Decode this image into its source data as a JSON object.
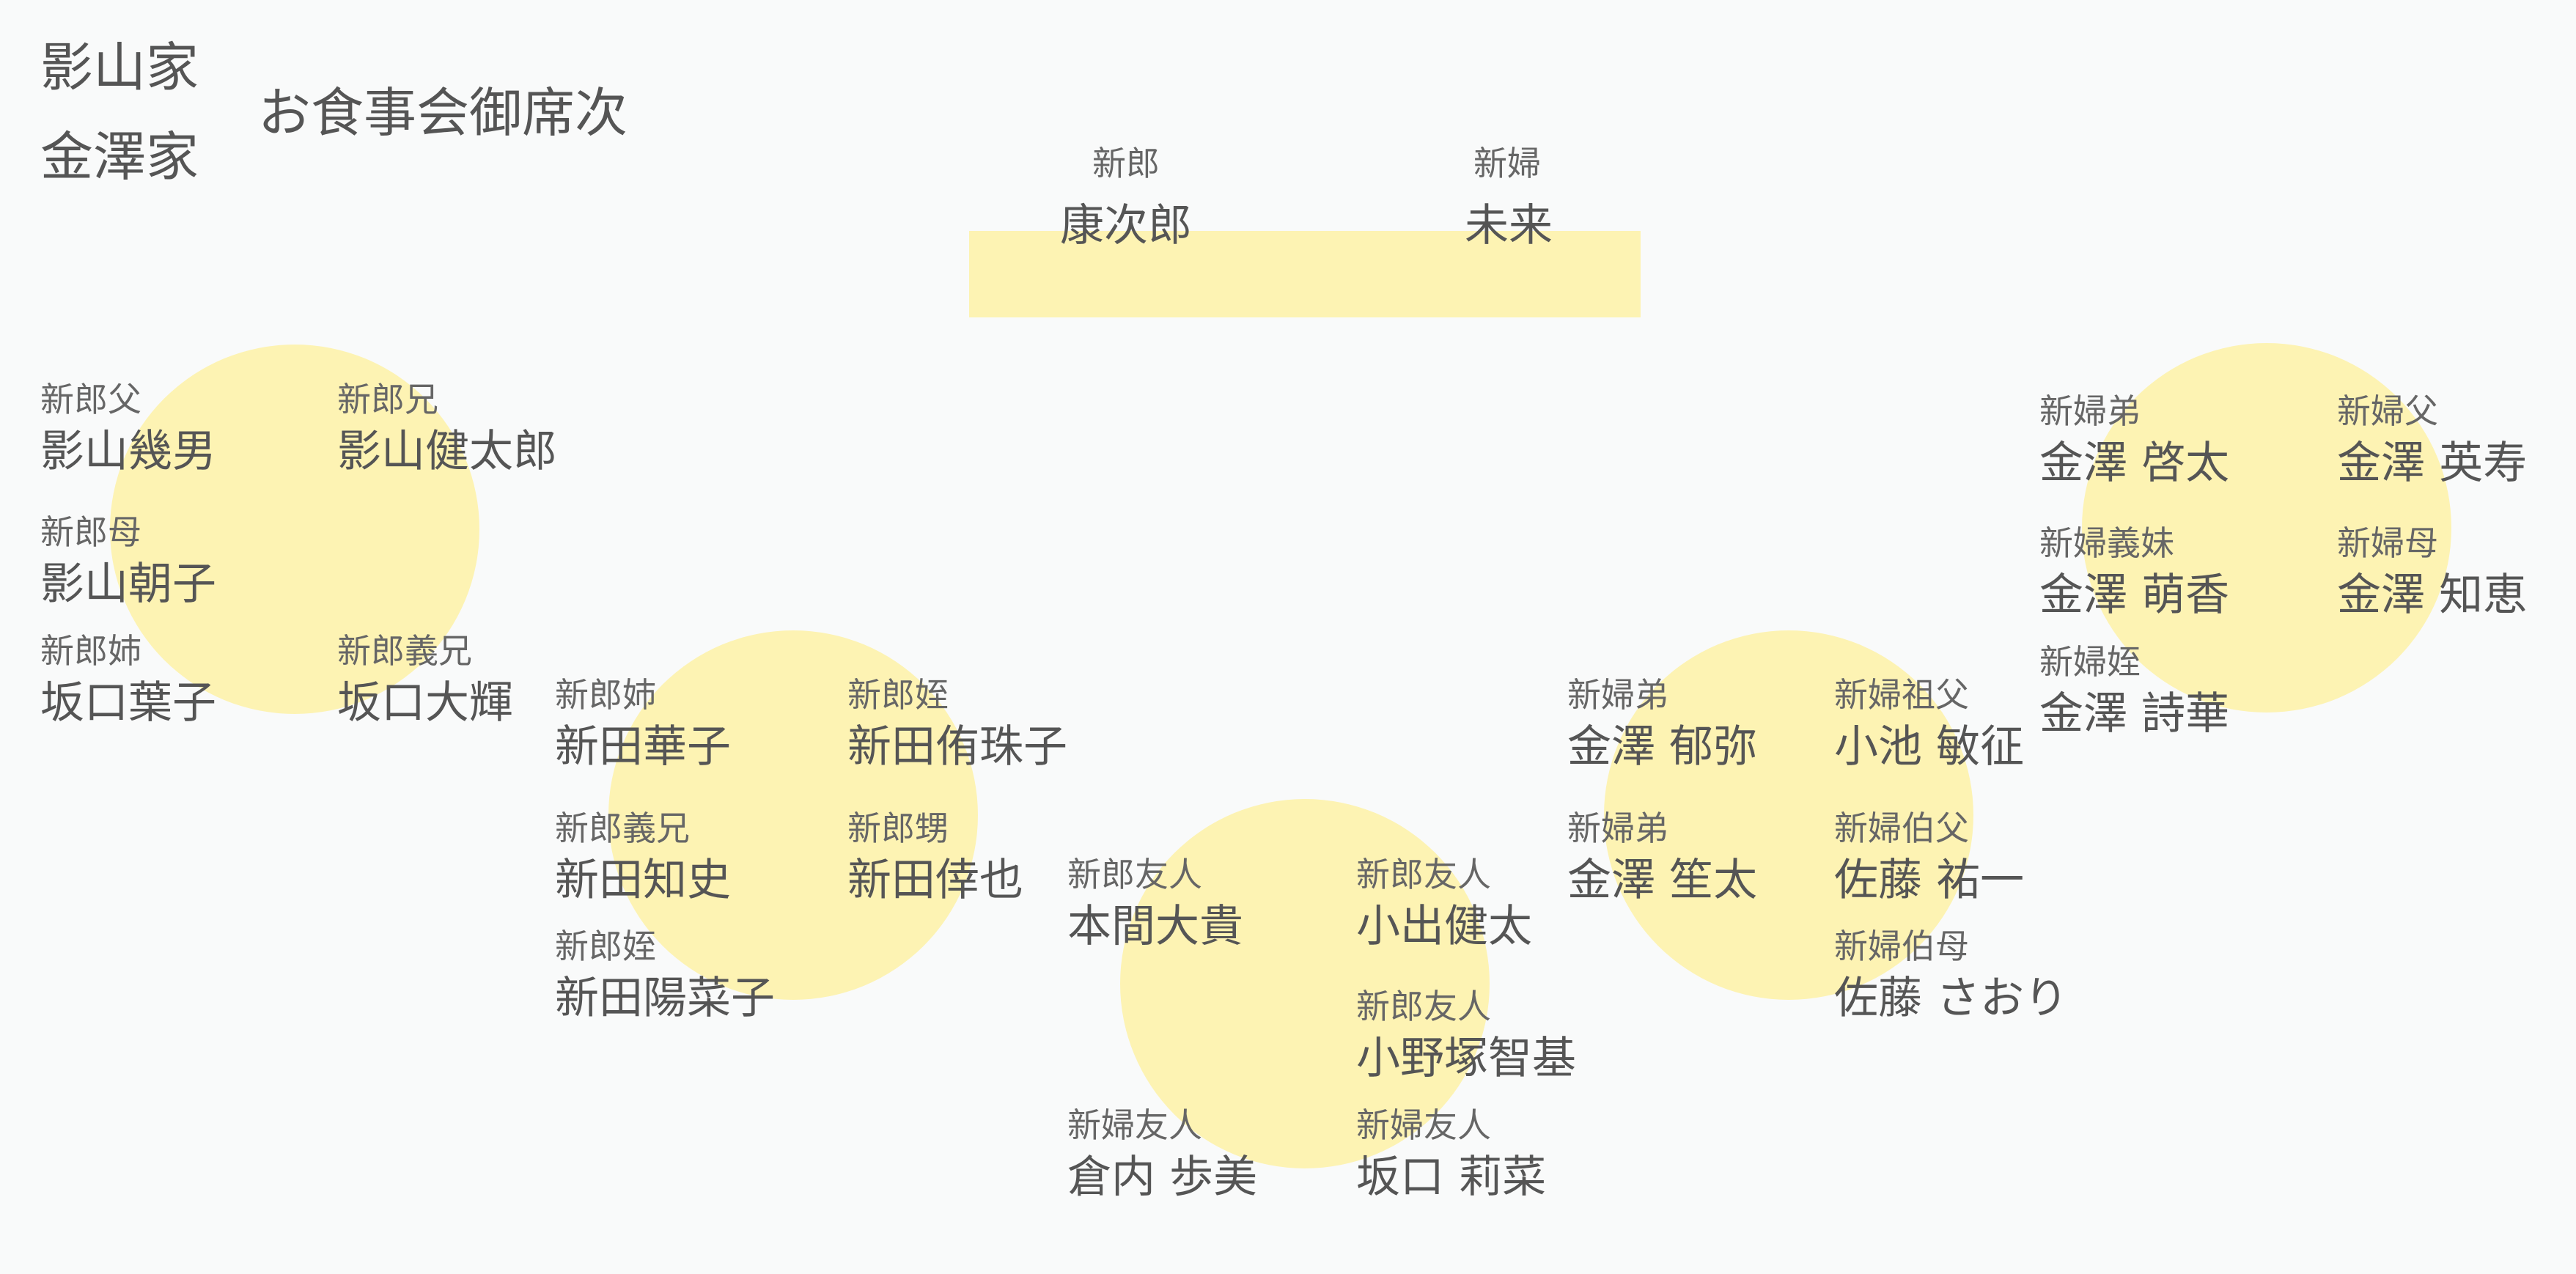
{
  "families": [
    "影山家",
    "金澤家"
  ],
  "title": "お食事会御席次",
  "head_table": {
    "groom": {
      "role": "新郎",
      "name": "康次郎"
    },
    "bride": {
      "role": "新婦",
      "name": "未来"
    }
  },
  "tables": [
    {
      "seats": [
        {
          "role": "新郎父",
          "name": "影山幾男"
        },
        {
          "role": "新郎母",
          "name": "影山朝子"
        },
        {
          "role": "新郎姉",
          "name": "坂口葉子"
        },
        {
          "role": "新郎兄",
          "name": "影山健太郎"
        },
        {
          "role": "新郎義兄",
          "name": "坂口大輝"
        }
      ]
    },
    {
      "seats": [
        {
          "role": "新郎姉",
          "name": "新田華子"
        },
        {
          "role": "新郎義兄",
          "name": "新田知史"
        },
        {
          "role": "新郎姪",
          "name": "新田陽菜子"
        },
        {
          "role": "新郎姪",
          "name": "新田侑珠子"
        },
        {
          "role": "新郎甥",
          "name": "新田倖也"
        }
      ]
    },
    {
      "seats": [
        {
          "role": "新郎友人",
          "name": "本間大貴"
        },
        {
          "role": "新婦友人",
          "name": "倉内 歩美"
        },
        {
          "role": "新郎友人",
          "name": "小出健太"
        },
        {
          "role": "新郎友人",
          "name": "小野塚智基"
        },
        {
          "role": "新婦友人",
          "name": "坂口 莉菜"
        }
      ]
    },
    {
      "seats": [
        {
          "role": "新婦弟",
          "name": "金澤 郁弥"
        },
        {
          "role": "新婦弟",
          "name": "金澤 笙太"
        },
        {
          "role": "新婦祖父",
          "name": "小池 敏征"
        },
        {
          "role": "新婦伯父",
          "name": "佐藤 祐一"
        },
        {
          "role": "新婦伯母",
          "name": "佐藤 さおり"
        }
      ]
    },
    {
      "seats": [
        {
          "role": "新婦弟",
          "name": "金澤 啓太"
        },
        {
          "role": "新婦義妹",
          "name": "金澤 萌香"
        },
        {
          "role": "新婦姪",
          "name": "金澤 詩華"
        },
        {
          "role": "新婦父",
          "name": "金澤 英寿"
        },
        {
          "role": "新婦母",
          "name": "金澤 知恵"
        }
      ]
    }
  ]
}
